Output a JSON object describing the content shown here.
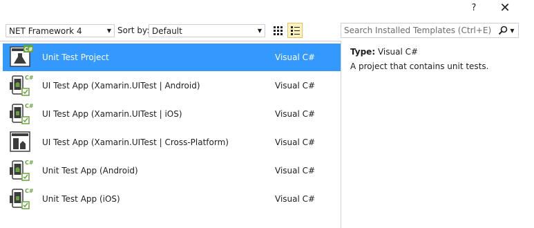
{
  "window": {
    "help_glyph": "?",
    "close_glyph": "✕"
  },
  "toolbar": {
    "framework": "NET Framework 4",
    "sort_label": "Sort by:",
    "sort_value": "Default",
    "search_placeholder": "Search Installed Templates (Ctrl+E)"
  },
  "templates": [
    {
      "name": "Unit Test Project",
      "lang": "Visual C#",
      "icon": "unit-test-project-icon",
      "selected": true
    },
    {
      "name": "UI Test App (Xamarin.UITest | Android)",
      "lang": "Visual C#",
      "icon": "android-test-app-icon"
    },
    {
      "name": "UI Test App (Xamarin.UITest | iOS)",
      "lang": "Visual C#",
      "icon": "ios-test-app-icon"
    },
    {
      "name": "UI Test App (Xamarin.UITest | Cross-Platform)",
      "lang": "Visual C#",
      "icon": "cross-platform-test-app-icon"
    },
    {
      "name": "Unit Test App (Android)",
      "lang": "Visual C#",
      "icon": "android-unit-test-app-icon"
    },
    {
      "name": "Unit Test App (iOS)",
      "lang": "Visual C#",
      "icon": "ios-unit-test-app-icon"
    }
  ],
  "details": {
    "type_label": "Type:",
    "type_value": "Visual C#",
    "description": "A project that contains unit tests."
  },
  "colors": {
    "selection": "#3399ff",
    "accent_green": "#68a23f",
    "border": "#cccedb"
  }
}
